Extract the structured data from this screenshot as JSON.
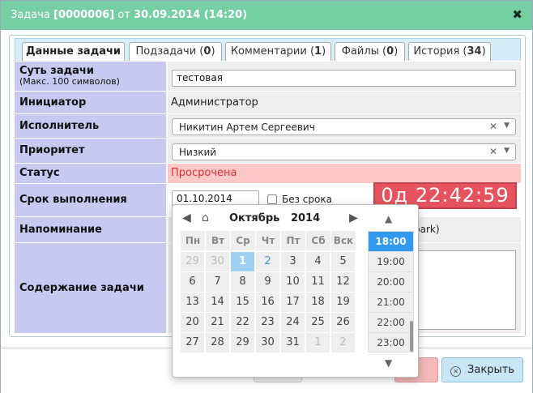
{
  "window": {
    "title_prefix": "Задача",
    "task_id": "[0000006]",
    "title_from": "от",
    "title_date": "30.09.2014 (14:20)"
  },
  "tabs": [
    {
      "label": "Данные задачи",
      "count": ""
    },
    {
      "label": "Подзадачи",
      "count": "0"
    },
    {
      "label": "Комментарии",
      "count": "1"
    },
    {
      "label": "Файлы",
      "count": "0"
    },
    {
      "label": "История",
      "count": "34"
    }
  ],
  "form": {
    "summary_label": "Суть задачи",
    "summary_hint": "(Макс. 100 символов)",
    "summary_value": "тестовая",
    "initiator_label": "Инициатор",
    "initiator_value": "Администратор",
    "executor_label": "Исполнитель",
    "executor_value": "Никитин Артем Сергеевич",
    "priority_label": "Приоритет",
    "priority_value": "Низкий",
    "status_label": "Статус",
    "status_value": "Просрочена",
    "deadline_label": "Срок выполнения",
    "deadline_value": "01.10.2014 18:00",
    "no_deadline_label": "Без срока",
    "reminder_label": "Напоминание",
    "reminder_value_partial": "park)",
    "content_label": "Содержание задачи"
  },
  "timer": "0д 22:42:59",
  "datepicker": {
    "month": "Октябрь",
    "year": "2014",
    "weekdays": [
      "Пн",
      "Вт",
      "Ср",
      "Чт",
      "Пт",
      "Сб",
      "Вск"
    ],
    "weeks": [
      [
        "29",
        "30",
        "1",
        "2",
        "3",
        "4",
        "5"
      ],
      [
        "6",
        "7",
        "8",
        "9",
        "10",
        "11",
        "12"
      ],
      [
        "13",
        "14",
        "15",
        "16",
        "17",
        "18",
        "19"
      ],
      [
        "20",
        "21",
        "22",
        "23",
        "24",
        "25",
        "26"
      ],
      [
        "27",
        "28",
        "29",
        "30",
        "31",
        "1",
        "2"
      ]
    ],
    "times": [
      "18:00",
      "19:00",
      "20:00",
      "21:00",
      "22:00",
      "23:00"
    ]
  },
  "footer": {
    "close_label": "Закрыть"
  }
}
